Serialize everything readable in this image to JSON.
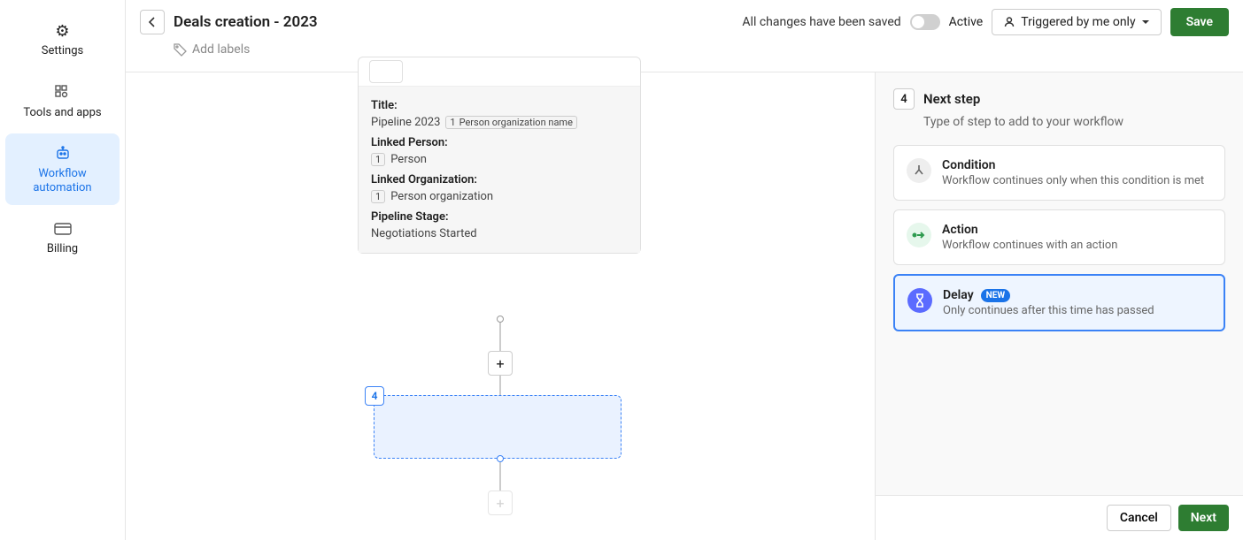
{
  "sidebar": {
    "items": [
      {
        "label": "Settings"
      },
      {
        "label": "Tools and apps"
      },
      {
        "label": "Workflow automation"
      },
      {
        "label": "Billing"
      }
    ]
  },
  "header": {
    "title": "Deals creation - 2023",
    "add_labels": "Add labels",
    "saved_msg": "All changes have been saved",
    "active_label": "Active",
    "trigger_label": "Triggered by me only",
    "save_label": "Save"
  },
  "card": {
    "title_label": "Title:",
    "title_value": "Pipeline 2023",
    "title_chip_num": "1",
    "title_chip_text": "Person organization name",
    "linked_person_label": "Linked Person:",
    "linked_person_chip_num": "1",
    "linked_person_value": "Person",
    "linked_org_label": "Linked Organization:",
    "linked_org_chip_num": "1",
    "linked_org_value": "Person organization",
    "stage_label": "Pipeline Stage:",
    "stage_value": "Negotiations Started"
  },
  "placeholder": {
    "num": "4"
  },
  "panel": {
    "step_num": "4",
    "title": "Next step",
    "subtitle": "Type of step to add to your workflow",
    "options": [
      {
        "title": "Condition",
        "desc": "Workflow continues only when this condition is met"
      },
      {
        "title": "Action",
        "desc": "Workflow continues with an action"
      },
      {
        "title": "Delay",
        "badge": "NEW",
        "desc": "Only continues after this time has passed"
      }
    ],
    "cancel": "Cancel",
    "next": "Next"
  }
}
